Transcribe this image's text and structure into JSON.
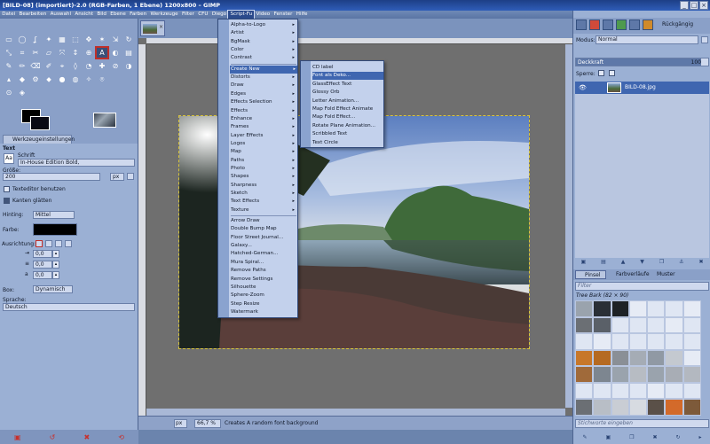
{
  "window": {
    "title": "[BILD-08] (importiert)-2.0 (RGB-Farben, 1 Ebene) 1200x800 – GIMP"
  },
  "menubar": {
    "items": [
      "Datei",
      "Bearbeiten",
      "Auswahl",
      "Ansicht",
      "Bild",
      "Ebene",
      "Farben",
      "Werkzeuge",
      "Filter",
      "CFU",
      "Diego",
      "Script-Fu",
      "Video",
      "Fenster",
      "Hilfe"
    ],
    "active_index": 11
  },
  "script_fu_menu": {
    "groups": [
      [
        "Alpha-to-Logo",
        "Artist",
        "BgMask",
        "Color",
        "Contrast"
      ],
      [
        "Create New",
        "Distorts",
        "Draw",
        "Edges",
        "Effects Selection",
        "Effects",
        "Enhance",
        "Frames",
        "Layer Effects",
        "Logos",
        "Map",
        "Paths",
        "Photo",
        "Shapes",
        "Sharpness",
        "Sketch",
        "Text Effects",
        "Texture"
      ],
      [
        "Arrow Draw",
        "Double Bump Map",
        "Floor Street Journal...",
        "Galaxy...",
        "Hatched-German...",
        "Mura Spiral...",
        "Remove Paths",
        "Remove Settings",
        "Silhouette",
        "Sphere-Zoom",
        "Step Resize",
        "Watermark"
      ]
    ],
    "highlighted": "Create New",
    "submenu_items": [
      "Create New",
      "Distorts",
      "Draw",
      "Edges",
      "Effects Selection",
      "Effects",
      "Enhance",
      "Frames",
      "Layer Effects",
      "Logos",
      "Map",
      "Paths",
      "Photo",
      "Shapes",
      "Sharpness",
      "Sketch",
      "Text Effects",
      "Texture",
      "Alpha-to-Logo",
      "Artist",
      "BgMask",
      "Color",
      "Contrast"
    ]
  },
  "create_new_menu": {
    "items": [
      "CD label",
      "Font als Deko...",
      "GlassEffect Text",
      "Glossy Orb",
      "Letter Animation...",
      "Map Fold Effect Animate",
      "Map Fold Effect...",
      "Rotate Plane Animation...",
      "Scribbled Text",
      "Text Circle"
    ],
    "highlighted": "Font als Deko..."
  },
  "tool_options": {
    "tab_label": "Werkzeugeinstellungen",
    "section": "Text",
    "font_label": "Schrift",
    "font_value": "In-House Edition Bold,",
    "size_label": "Größe:",
    "size_value": "200",
    "size_unit": "px",
    "use_editor_label": "Texteditor benutzen",
    "antialias_label": "Kanten glätten",
    "hinting_label": "Hinting:",
    "hinting_value": "Mittel",
    "color_label": "Farbe:",
    "justify_label": "Ausrichtung:",
    "indent_value": "0,0",
    "line_spacing_value": "0,0",
    "letter_spacing_value": "0,0",
    "box_label": "Box:",
    "box_value": "Dynamisch",
    "language_label": "Sprache:",
    "language_value": "Deutsch"
  },
  "statusbar": {
    "unit": "px",
    "zoom": "66,7 %",
    "message": "Creates A random font background"
  },
  "layers_dock": {
    "undo_tab_label": "Rückgängig",
    "mode_label": "Modus:",
    "mode_value": "Normal",
    "opacity_label": "Deckkraft",
    "opacity_value": "100",
    "opacity_fraction": 1.0,
    "lock_label": "Sperre:",
    "layer_name": "BILD-08.jpg"
  },
  "brushes_dock": {
    "tabs": [
      "Pinsel",
      "Farbverläufe",
      "Muster"
    ],
    "filter_placeholder": "Filter",
    "selected_name": "Tree Bark (82 × 90)",
    "tag_placeholder": "Stichworte eingeben"
  },
  "colors": {
    "accent": "#3f66b0",
    "selection_outline": "#c0302a",
    "titlebar": "#1d3f86"
  }
}
